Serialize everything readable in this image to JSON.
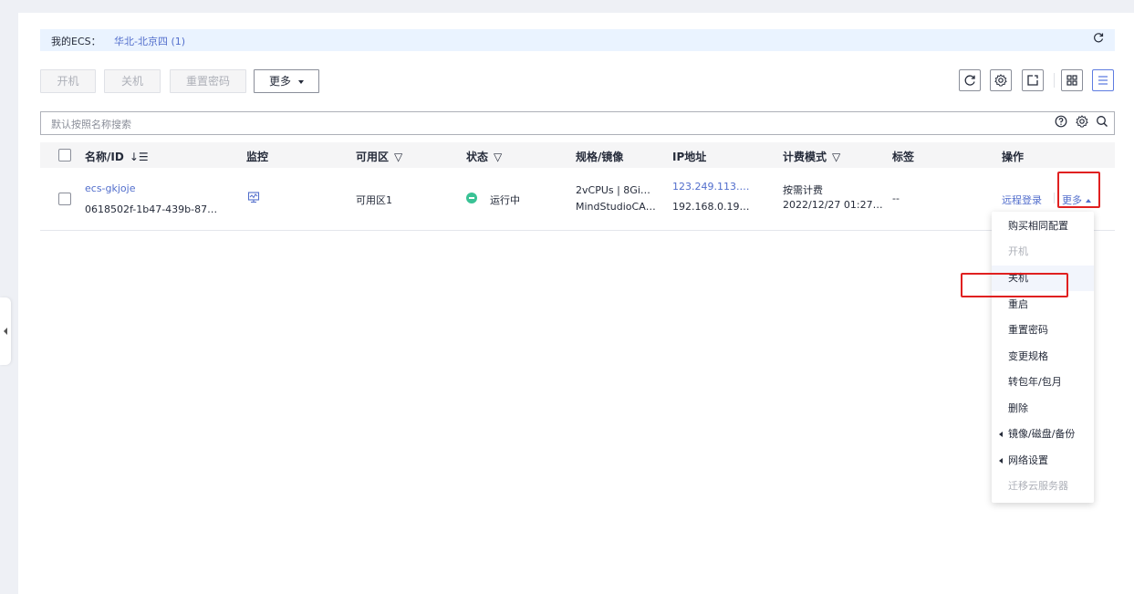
{
  "region": {
    "label": "我的ECS：",
    "value": "华北-北京四 (1)"
  },
  "toolbar": {
    "start": "开机",
    "stop": "关机",
    "reset_password": "重置密码",
    "more": "更多"
  },
  "search": {
    "placeholder": "默认按照名称搜索"
  },
  "table": {
    "headers": {
      "name": "名称/ID",
      "monitor": "监控",
      "az": "可用区",
      "status": "状态",
      "spec": "规格/镜像",
      "ip": "IP地址",
      "billing": "计费模式",
      "tags": "标签",
      "ops": "操作"
    },
    "rows": [
      {
        "name": "ecs-gkjoje",
        "id": "0618502f-1b47-439b-87…",
        "az": "可用区1",
        "status": "运行中",
        "spec": "2vCPUs | 8Gi…",
        "image": "MindStudioCA…",
        "public_ip": "123.249.113.…",
        "private_ip": "192.168.0.19…",
        "billing": "按需计费",
        "created": "2022/12/27 01:27…",
        "tags": "--",
        "remote_login": "远程登录",
        "more": "更多"
      }
    ]
  },
  "menu": {
    "items": [
      "购买相同配置",
      "开机",
      "关机",
      "重启",
      "重置密码",
      "变更规格",
      "转包年/包月",
      "删除",
      "镜像/磁盘/备份",
      "网络设置",
      "迁移云服务器"
    ]
  },
  "colors": {
    "accent": "#5e7ce0",
    "link": "#526ecc",
    "running": "#3ac295",
    "highlight_box": "#e02020"
  }
}
